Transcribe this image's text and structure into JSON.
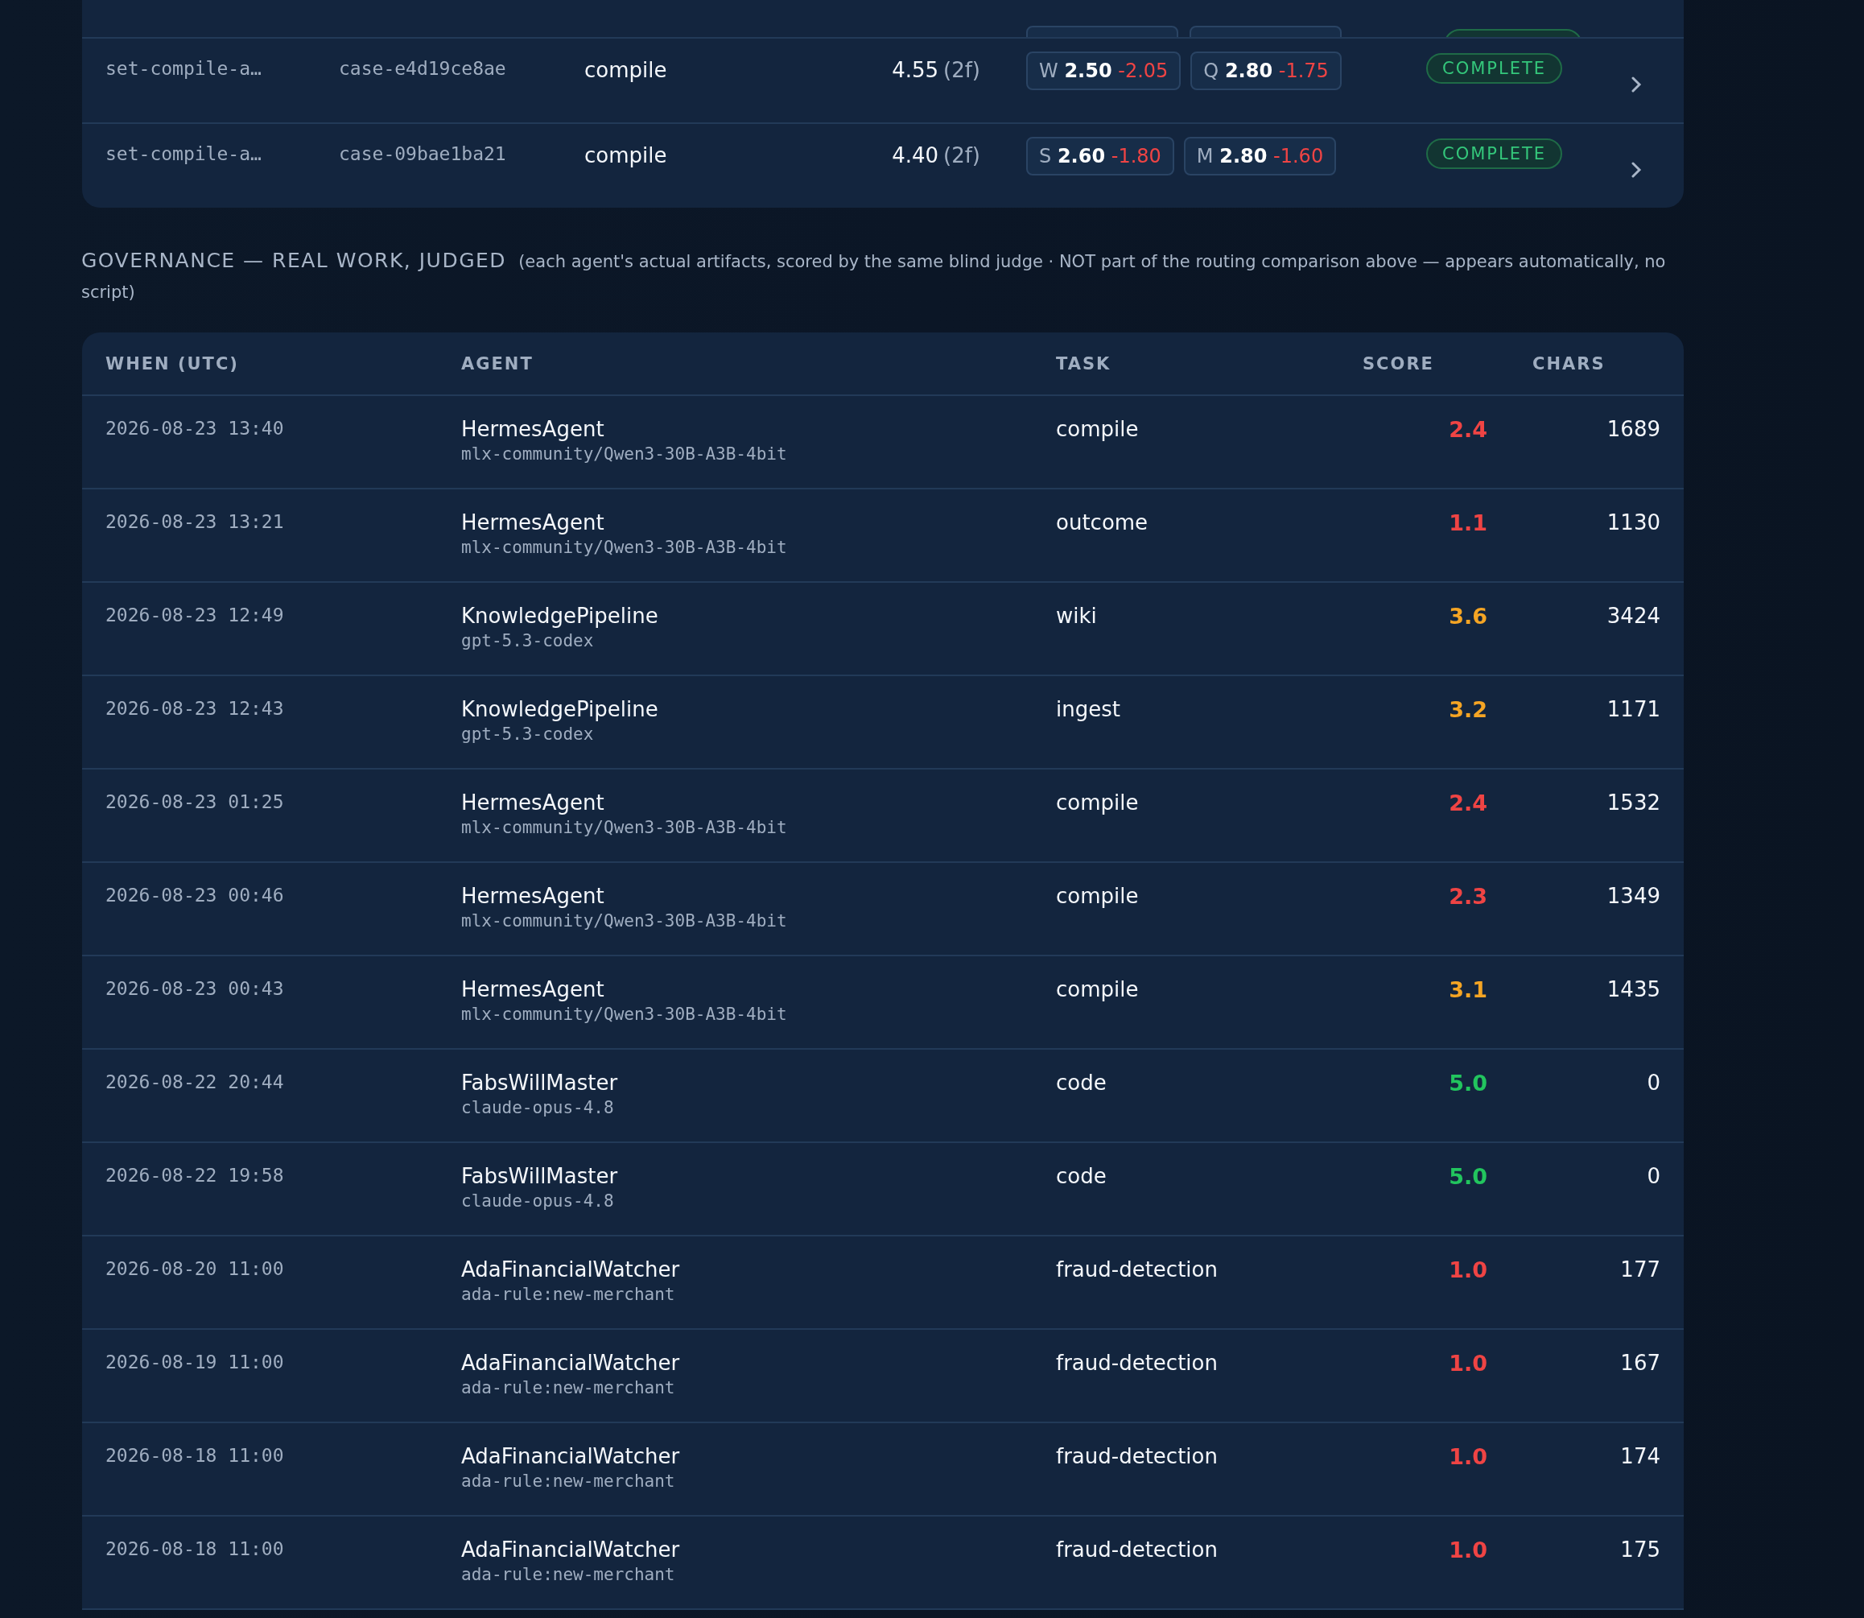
{
  "runs": {
    "rows": [
      {
        "set": "set-compile-a…",
        "case": "case-e4d19ce8ae",
        "task": "compile",
        "score": "4.55",
        "floors": "(2f)",
        "chips": [
          {
            "letter": "W",
            "value": "2.50",
            "delta": "-2.05"
          },
          {
            "letter": "Q",
            "value": "2.80",
            "delta": "-1.75"
          }
        ],
        "status": "COMPLETE"
      },
      {
        "set": "set-compile-a…",
        "case": "case-09bae1ba21",
        "task": "compile",
        "score": "4.40",
        "floors": "(2f)",
        "chips": [
          {
            "letter": "S",
            "value": "2.60",
            "delta": "-1.80"
          },
          {
            "letter": "M",
            "value": "2.80",
            "delta": "-1.60"
          }
        ],
        "status": "COMPLETE"
      }
    ]
  },
  "governance": {
    "title": "GOVERNANCE — REAL WORK, JUDGED",
    "note": "(each agent's actual artifacts, scored by the same blind judge · NOT part of the routing comparison above — appears automatically, no script)",
    "columns": [
      "WHEN (UTC)",
      "AGENT",
      "TASK",
      "SCORE",
      "CHARS"
    ],
    "rows": [
      {
        "when": "2026-08-23 13:40",
        "agent": "HermesAgent",
        "model": "mlx-community/Qwen3-30B-A3B-4bit",
        "task": "compile",
        "score": "2.4",
        "color": "#ef4444",
        "chars": "1689"
      },
      {
        "when": "2026-08-23 13:21",
        "agent": "HermesAgent",
        "model": "mlx-community/Qwen3-30B-A3B-4bit",
        "task": "outcome",
        "score": "1.1",
        "color": "#ef4444",
        "chars": "1130"
      },
      {
        "when": "2026-08-23 12:49",
        "agent": "KnowledgePipeline",
        "model": "gpt-5.3-codex",
        "task": "wiki",
        "score": "3.6",
        "color": "#f5a524",
        "chars": "3424"
      },
      {
        "when": "2026-08-23 12:43",
        "agent": "KnowledgePipeline",
        "model": "gpt-5.3-codex",
        "task": "ingest",
        "score": "3.2",
        "color": "#f5a524",
        "chars": "1171"
      },
      {
        "when": "2026-08-23 01:25",
        "agent": "HermesAgent",
        "model": "mlx-community/Qwen3-30B-A3B-4bit",
        "task": "compile",
        "score": "2.4",
        "color": "#ef4444",
        "chars": "1532"
      },
      {
        "when": "2026-08-23 00:46",
        "agent": "HermesAgent",
        "model": "mlx-community/Qwen3-30B-A3B-4bit",
        "task": "compile",
        "score": "2.3",
        "color": "#ef4444",
        "chars": "1349"
      },
      {
        "when": "2026-08-23 00:43",
        "agent": "HermesAgent",
        "model": "mlx-community/Qwen3-30B-A3B-4bit",
        "task": "compile",
        "score": "3.1",
        "color": "#f5a524",
        "chars": "1435"
      },
      {
        "when": "2026-08-22 20:44",
        "agent": "FabsWillMaster",
        "model": "claude-opus-4.8",
        "task": "code",
        "score": "5.0",
        "color": "#22c55e",
        "chars": "0"
      },
      {
        "when": "2026-08-22 19:58",
        "agent": "FabsWillMaster",
        "model": "claude-opus-4.8",
        "task": "code",
        "score": "5.0",
        "color": "#22c55e",
        "chars": "0"
      },
      {
        "when": "2026-08-20 11:00",
        "agent": "AdaFinancialWatcher",
        "model": "ada-rule:new-merchant",
        "task": "fraud-detection",
        "score": "1.0",
        "color": "#ef4444",
        "chars": "177"
      },
      {
        "when": "2026-08-19 11:00",
        "agent": "AdaFinancialWatcher",
        "model": "ada-rule:new-merchant",
        "task": "fraud-detection",
        "score": "1.0",
        "color": "#ef4444",
        "chars": "167"
      },
      {
        "when": "2026-08-18 11:00",
        "agent": "AdaFinancialWatcher",
        "model": "ada-rule:new-merchant",
        "task": "fraud-detection",
        "score": "1.0",
        "color": "#ef4444",
        "chars": "174"
      },
      {
        "when": "2026-08-18 11:00",
        "agent": "AdaFinancialWatcher",
        "model": "ada-rule:new-merchant",
        "task": "fraud-detection",
        "score": "1.0",
        "color": "#ef4444",
        "chars": "175"
      }
    ]
  }
}
